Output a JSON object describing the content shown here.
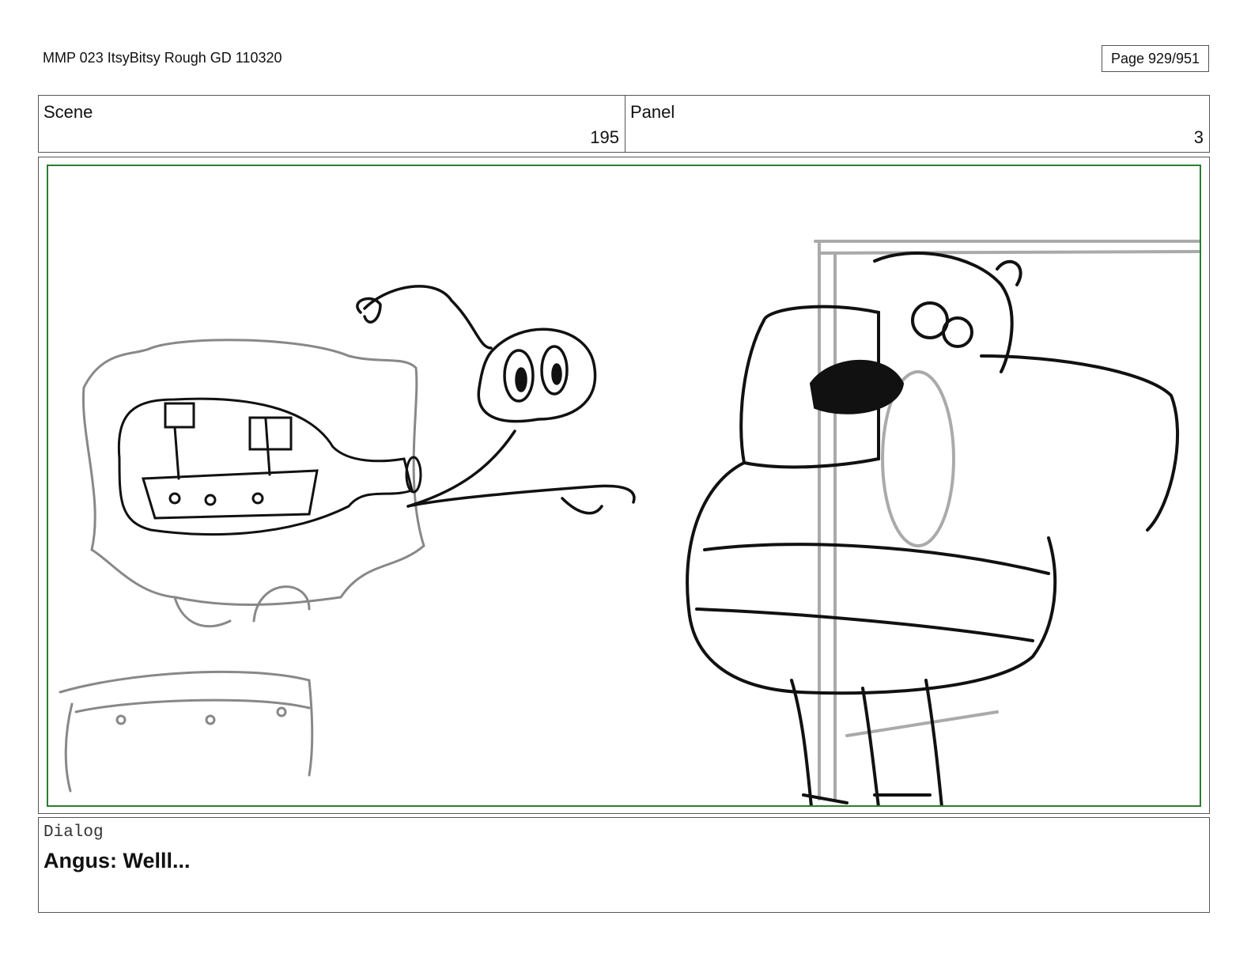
{
  "header": {
    "title": "MMP 023 ItsyBitsy Rough GD 110320",
    "page": "Page 929/951"
  },
  "info": {
    "scene_label": "Scene",
    "scene_value": "195",
    "panel_label": "Panel",
    "panel_value": "3"
  },
  "frame": {
    "border_color": "#2e7d32"
  },
  "dialog": {
    "label": "Dialog",
    "text": "Angus: Welll..."
  }
}
